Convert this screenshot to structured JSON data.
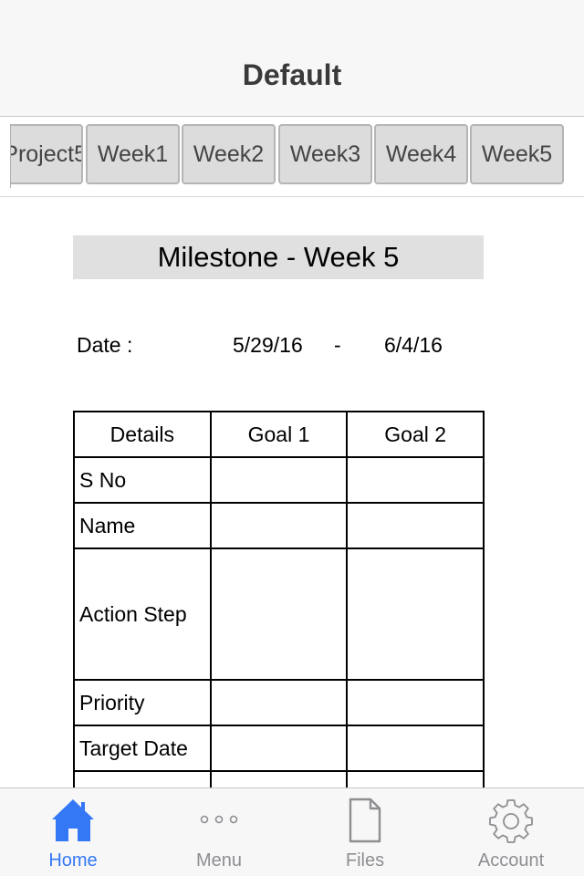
{
  "navbar": {
    "title": "Default"
  },
  "top_tabs": [
    {
      "label": "Project5"
    },
    {
      "label": "Week1"
    },
    {
      "label": "Week2"
    },
    {
      "label": "Week3"
    },
    {
      "label": "Week4"
    },
    {
      "label": "Week5"
    }
  ],
  "milestone": {
    "title": "Milestone - Week 5"
  },
  "date": {
    "label": "Date :",
    "start": "5/29/16",
    "separator": "-",
    "end": "6/4/16"
  },
  "table": {
    "headers": [
      "Details",
      "Goal 1",
      "Goal 2"
    ],
    "rows": [
      "S No",
      "Name",
      "Action Step",
      "Priority",
      "Target Date",
      ""
    ]
  },
  "tabbar": {
    "items": [
      {
        "label": "Home",
        "icon": "home-icon",
        "active": true
      },
      {
        "label": "Menu",
        "icon": "more-dots-icon",
        "active": false
      },
      {
        "label": "Files",
        "icon": "file-icon",
        "active": false
      },
      {
        "label": "Account",
        "icon": "gear-icon",
        "active": false
      }
    ]
  },
  "colors": {
    "accent": "#3478f6",
    "inactive": "#8e8e93",
    "tab_bg": "#dcdcdc",
    "milestone_bg": "#e0e0e0"
  }
}
